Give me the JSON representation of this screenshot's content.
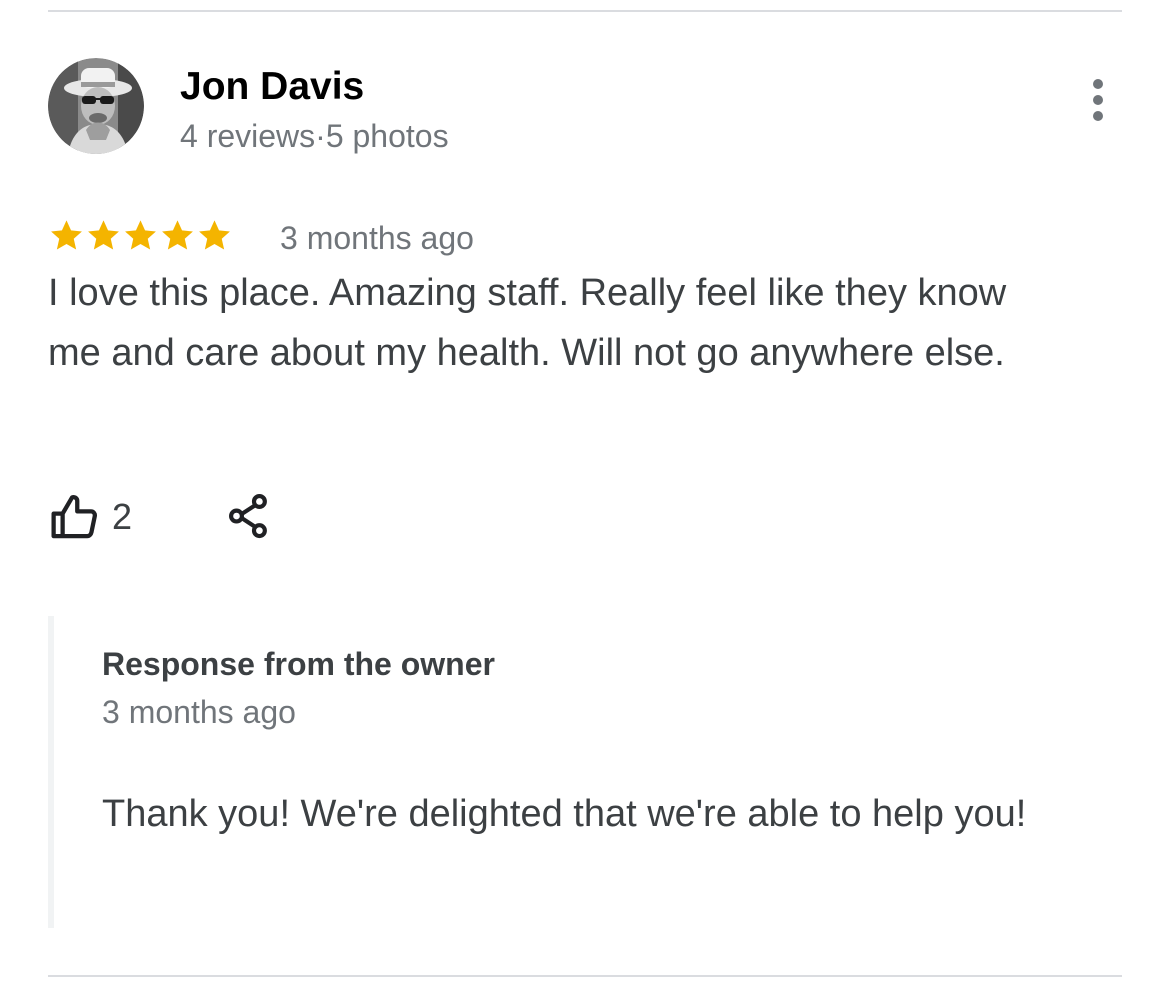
{
  "review": {
    "author_name": "Jon Davis",
    "author_meta": "4 reviews·5 photos",
    "rating": 5,
    "max_rating": 5,
    "date": "3 months ago",
    "text": "I love this place. Amazing staff. Really feel like they know me and care about my health. Will not go anywhere else.",
    "like_count": "2"
  },
  "owner_response": {
    "title": "Response from the owner",
    "date": "3 months ago",
    "text": "Thank you! We're delighted that we're able to help you!"
  },
  "icons": {
    "star": "star-icon",
    "more": "more-vert-icon",
    "like": "thumbs-up-icon",
    "share": "share-icon"
  },
  "colors": {
    "star": "#f4b400",
    "secondary_text": "#70757a",
    "primary_text": "#202124",
    "body_text": "#3c4043",
    "divider": "#dadce0",
    "response_border": "#f1f3f4"
  }
}
